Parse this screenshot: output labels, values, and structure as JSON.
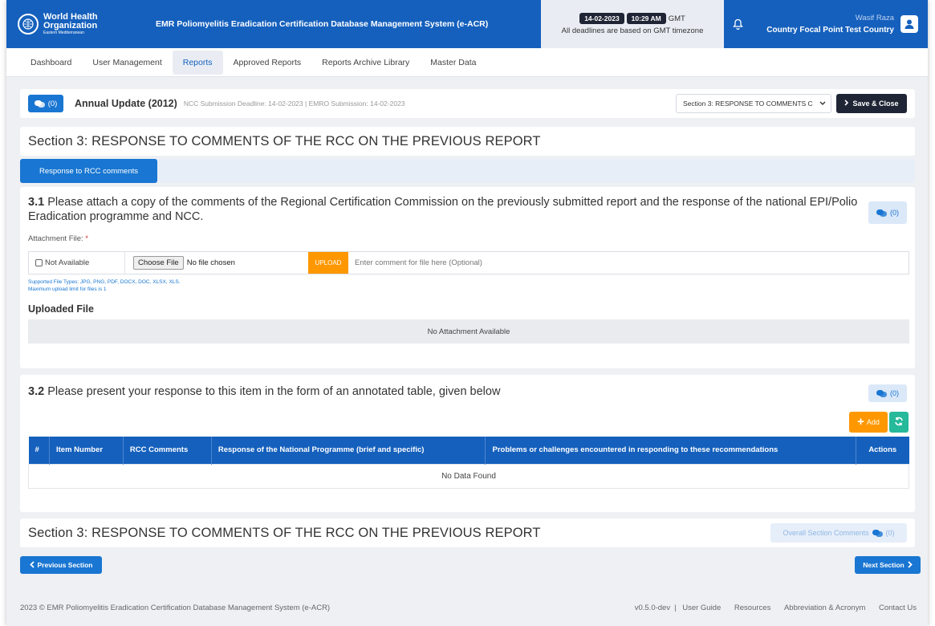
{
  "header": {
    "org_name_line1": "World Health",
    "org_name_line2": "Organization",
    "org_region": "Eastern Mediterranean",
    "system_title": "EMR Poliomyelitis Eradication Certification Database Management System (e-ACR)",
    "date": "14-02-2023",
    "time": "10:29 AM",
    "timezone": "GMT",
    "deadline_note": "All deadlines are based on GMT timezone",
    "user_name": "Wasif Raza",
    "user_role": "Country Focal Point Test Country"
  },
  "nav": {
    "items": [
      {
        "label": "Dashboard"
      },
      {
        "label": "User Management"
      },
      {
        "label": "Reports"
      },
      {
        "label": "Approved Reports"
      },
      {
        "label": "Reports Archive Library"
      },
      {
        "label": "Master Data"
      }
    ],
    "active": "Reports"
  },
  "report_bar": {
    "comments_count": "(0)",
    "title": "Annual Update (2012)",
    "deadlines": "NCC Submission Deadline: 14-02-2023 | EMRO Submission: 14-02-2023",
    "section_select": "Section 3: RESPONSE TO COMMENTS C",
    "save_close": "Save & Close"
  },
  "section": {
    "title": "Section 3: RESPONSE TO COMMENTS OF THE RCC ON THE PREVIOUS REPORT",
    "tab": "Response to RCC comments"
  },
  "q31": {
    "num": "3.1",
    "text": " Please attach a copy of the comments of the Regional Certification Commission on the previously submitted report and the response of the national EPI/Polio Eradication programme and NCC.",
    "comments_count": "(0)",
    "attachment_label": "Attachment File:",
    "required_mark": "*",
    "not_available": "Not Available",
    "choose_file": "Choose File",
    "no_file": "No file chosen",
    "upload": "UPLOAD",
    "comment_placeholder": "Enter comment for file here (Optional)",
    "supported_types": "Supported File Types: JPG, PNG, PDF, DOCX, DOC, XLSX, XLS.",
    "max_upload": "Maximum upload limit for files is 1",
    "uploaded_title": "Uploaded File",
    "no_attachment": "No Attachment Available"
  },
  "q32": {
    "num": "3.2",
    "text": " Please present your response to this item in the form of an annotated table, given below",
    "comments_count": "(0)",
    "add": "Add",
    "columns": [
      "#",
      "Item Number",
      "RCC Comments",
      "Response of the National Programme (brief and specific)",
      "Problems or challenges encountered in responding to these recommendations",
      "Actions"
    ],
    "empty": "No Data Found"
  },
  "bottom": {
    "section_title": "Section 3: RESPONSE TO COMMENTS OF THE RCC ON THE PREVIOUS REPORT",
    "overall_comments": "Overall Section Comments",
    "overall_count": "(0)",
    "prev": "Previous Section",
    "next": "Next Section"
  },
  "footer": {
    "copyright": "2023 ©  EMR Poliomyelitis Eradication Certification Database Management System (e-ACR)",
    "version": "v0.5.0-dev",
    "links": [
      "User Guide",
      "Resources",
      "Abbreviation & Acronym",
      "Contact Us"
    ]
  },
  "colors": {
    "primary": "#1560bd",
    "accent_orange": "#ff9800",
    "accent_green": "#26b99a",
    "dark": "#1f2535"
  }
}
